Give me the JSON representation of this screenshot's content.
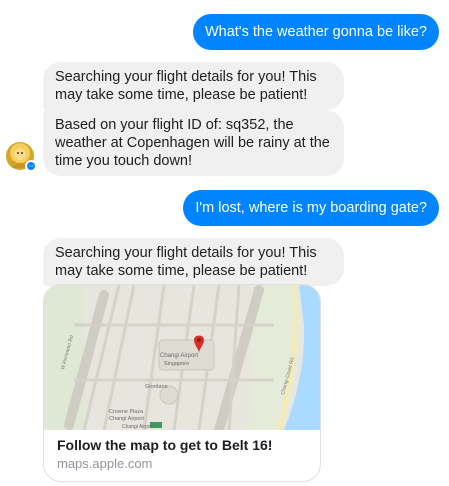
{
  "messages": {
    "m1": "What's the weather gonna be like?",
    "m2": "Searching your flight details for you! This may take some time, please be patient!",
    "m3": "Based on your flight ID of: sq352, the weather at Copenhagen will be rainy at the time you touch down!",
    "m4": "I'm lost, where is my boarding gate?",
    "m5": "Searching your flight details for you! This may take some time, please be patient!"
  },
  "card": {
    "title": "Follow the map to get to Belt 16!",
    "domain": "maps.apple.com",
    "map_labels": {
      "airport": "Changi Airport",
      "airport_sub": "Singapore",
      "hotel": "Crowne Plaza",
      "hotel_sub": "Changi Airport",
      "giordano": "Giordano",
      "road_left": "W Perimeter Rd",
      "road_right": "Changi Coast Rd",
      "badge": "Changi Airport"
    }
  },
  "colors": {
    "outgoing": "#0084ff",
    "incoming": "#f1f0f0",
    "map_pin": "#d93025"
  },
  "icons": {
    "messenger_badge": "messenger-badge-icon",
    "map_pin": "map-pin-icon"
  }
}
